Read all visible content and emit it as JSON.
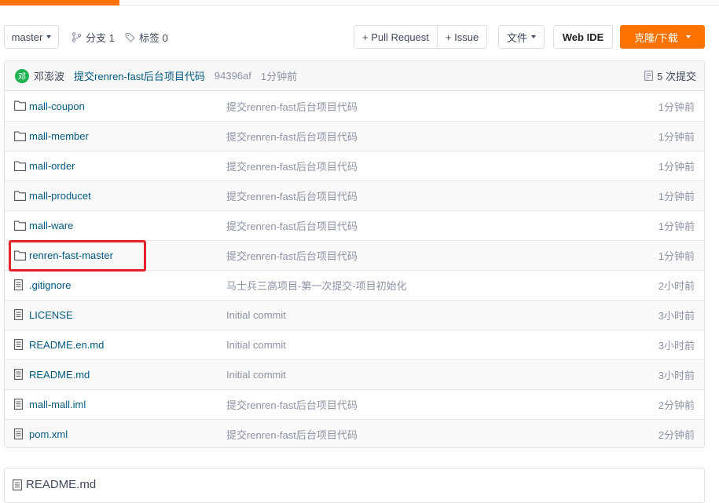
{
  "toolbar": {
    "branch_select": "master",
    "branches_label": "分支 1",
    "tags_label": "标签 0",
    "pull_request_label": "+ Pull Request",
    "issue_label": "+ Issue",
    "files_label": "文件",
    "webide_label": "Web IDE",
    "clone_label": "克隆/下载"
  },
  "commit": {
    "avatar_text": "邓",
    "author": "邓澎波",
    "message": "提交renren-fast后台项目代码",
    "hash": "94396af",
    "time": "1分钟前",
    "count_label": "5 次提交"
  },
  "files": [
    {
      "name": "mall-coupon",
      "type": "folder",
      "message": "提交renren-fast后台项目代码",
      "time": "1分钟前"
    },
    {
      "name": "mall-member",
      "type": "folder",
      "message": "提交renren-fast后台项目代码",
      "time": "1分钟前"
    },
    {
      "name": "mall-order",
      "type": "folder",
      "message": "提交renren-fast后台项目代码",
      "time": "1分钟前"
    },
    {
      "name": "mall-producet",
      "type": "folder",
      "message": "提交renren-fast后台项目代码",
      "time": "1分钟前"
    },
    {
      "name": "mall-ware",
      "type": "folder",
      "message": "提交renren-fast后台项目代码",
      "time": "1分钟前"
    },
    {
      "name": "renren-fast-master",
      "type": "folder",
      "message": "提交renren-fast后台项目代码",
      "time": "1分钟前"
    },
    {
      "name": ".gitignore",
      "type": "file",
      "message": "马士兵三高项目-第一次提交-项目初始化",
      "time": "2小时前"
    },
    {
      "name": "LICENSE",
      "type": "file",
      "message": "Initial commit",
      "time": "3小时前"
    },
    {
      "name": "README.en.md",
      "type": "file",
      "message": "Initial commit",
      "time": "3小时前"
    },
    {
      "name": "README.md",
      "type": "file",
      "message": "Initial commit",
      "time": "3小时前"
    },
    {
      "name": "mall-mall.iml",
      "type": "file",
      "message": "提交renren-fast后台项目代码",
      "time": "2分钟前"
    },
    {
      "name": "pom.xml",
      "type": "file",
      "message": "提交renren-fast后台项目代码",
      "time": "2分钟前"
    }
  ],
  "readme": {
    "title": "README.md"
  },
  "colors": {
    "accent": "#fe7300",
    "link": "#005980",
    "highlight": "#e6212a",
    "avatar": "#21b351"
  }
}
